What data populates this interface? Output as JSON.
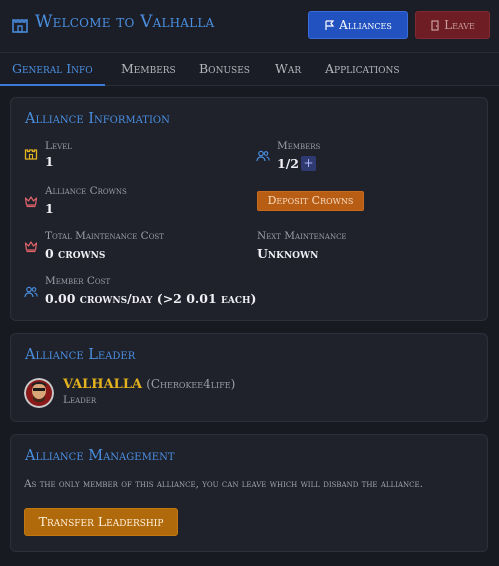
{
  "header": {
    "title": "Welcome to Valhalla",
    "alliances_label": "Alliances",
    "leave_label": "Leave"
  },
  "tabs": [
    {
      "label": "General Info",
      "active": true
    },
    {
      "label": "Members",
      "active": false
    },
    {
      "label": "Bonuses",
      "active": false
    },
    {
      "label": "War",
      "active": false
    },
    {
      "label": "Applications",
      "active": false
    }
  ],
  "alliance_info": {
    "title": "Alliance Information",
    "level": {
      "label": "Level",
      "value": "1"
    },
    "members": {
      "label": "Members",
      "value": "1/2",
      "add_label": "+"
    },
    "crowns": {
      "label": "Alliance Crowns",
      "value": "1"
    },
    "deposit_label": "Deposit Crowns",
    "maintenance_cost": {
      "label": "Total Maintenance Cost",
      "value": "0 crowns"
    },
    "next_maintenance": {
      "label": "Next Maintenance",
      "value": "Unknown"
    },
    "member_cost": {
      "label": "Member Cost",
      "value": "0.00 crowns/day (>2 0.01 each)"
    }
  },
  "alliance_leader": {
    "title": "Alliance Leader",
    "name": "VALHALLA",
    "username": "(Cherokee4life)",
    "role": "Leader"
  },
  "alliance_management": {
    "title": "Alliance Management",
    "description": "As the only member of this alliance, you can leave which will disband the alliance.",
    "transfer_label": "Transfer Leadership"
  },
  "colors": {
    "accent": "#4a8fe0",
    "gold": "#e3b21f",
    "danger": "#6d1d23",
    "orange": "#b75d14"
  }
}
